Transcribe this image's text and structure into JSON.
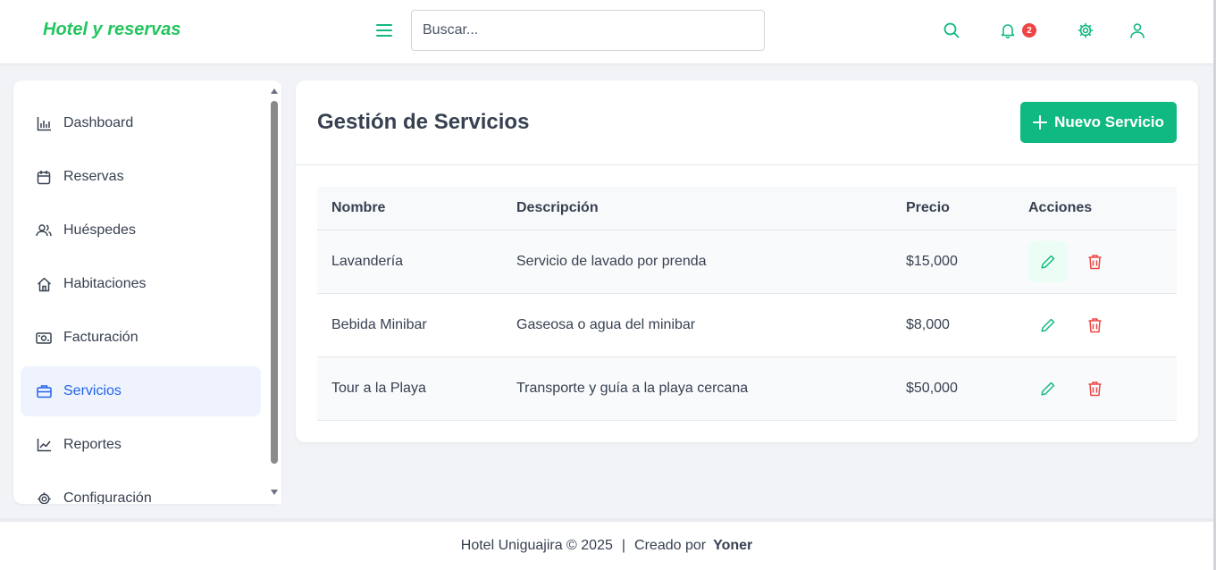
{
  "header": {
    "brand": "Hotel y reservas",
    "search_placeholder": "Buscar...",
    "notification_count": "2"
  },
  "sidebar": {
    "items": [
      {
        "label": "Dashboard",
        "icon": "chart-bar-icon"
      },
      {
        "label": "Reservas",
        "icon": "calendar-icon"
      },
      {
        "label": "Huéspedes",
        "icon": "users-icon"
      },
      {
        "label": "Habitaciones",
        "icon": "home-icon"
      },
      {
        "label": "Facturación",
        "icon": "cash-icon"
      },
      {
        "label": "Servicios",
        "icon": "briefcase-icon",
        "active": true
      },
      {
        "label": "Reportes",
        "icon": "trend-icon"
      },
      {
        "label": "Configuración",
        "icon": "gear-icon"
      }
    ]
  },
  "main": {
    "title": "Gestión de Servicios",
    "new_button": "Nuevo Servicio",
    "table": {
      "headers": [
        "Nombre",
        "Descripción",
        "Precio",
        "Acciones"
      ],
      "rows": [
        {
          "nombre": "Lavandería",
          "descripcion": "Servicio de lavado por prenda",
          "precio": "$15,000"
        },
        {
          "nombre": "Bebida Minibar",
          "descripcion": "Gaseosa o agua del minibar",
          "precio": "$8,000"
        },
        {
          "nombre": "Tour a la Playa",
          "descripcion": "Transporte y guía a la playa cercana",
          "precio": "$50,000"
        }
      ]
    }
  },
  "footer": {
    "copyright": "Hotel Uniguajira © 2025",
    "separator": "|",
    "created_by": "Creado por",
    "author": "Yoner"
  },
  "colors": {
    "accent": "#10b981",
    "brand": "#22c55e",
    "active_nav": "#2563eb",
    "danger": "#ef4444"
  }
}
